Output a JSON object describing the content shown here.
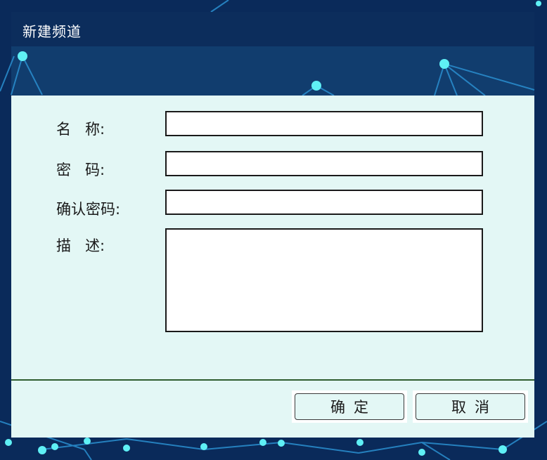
{
  "dialog": {
    "title": "新建频道"
  },
  "form": {
    "name_label": "名   称:",
    "password_label": "密   码:",
    "confirm_label": "确认密码:",
    "description_label": "描   述:",
    "name_value": "",
    "password_value": "",
    "confirm_value": "",
    "description_value": ""
  },
  "buttons": {
    "ok_label": "确定",
    "cancel_label": "取消"
  },
  "colors": {
    "background": "#0a2a5a",
    "titlebar": "#0c2d5c",
    "body": "#e3f7f5",
    "node": "#5ff0f5",
    "divider": "#2f5d2f"
  }
}
